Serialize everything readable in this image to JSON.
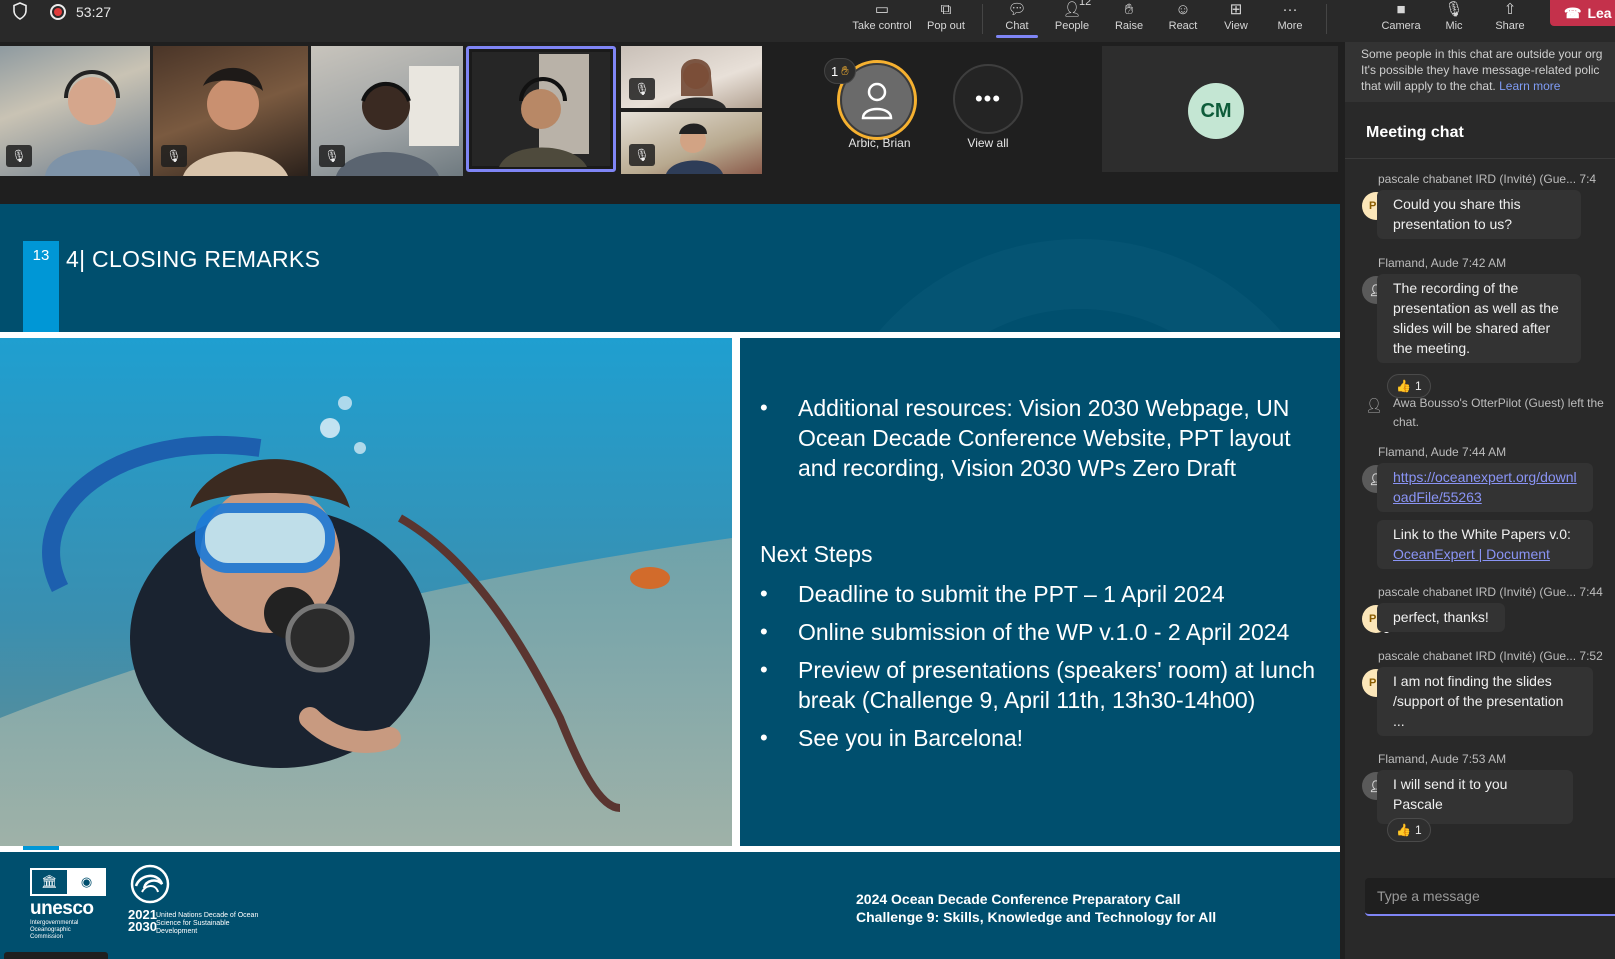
{
  "topbar": {
    "timer": "53:27",
    "buttons": [
      {
        "label": "Take control",
        "icon": "take-control-icon"
      },
      {
        "label": "Pop out",
        "icon": "pop-out-icon"
      },
      {
        "label": "Chat",
        "icon": "chat-icon"
      },
      {
        "label": "People",
        "icon": "people-icon",
        "badge": "12"
      },
      {
        "label": "Raise",
        "icon": "raise-hand-icon"
      },
      {
        "label": "React",
        "icon": "react-icon"
      },
      {
        "label": "View",
        "icon": "view-icon"
      },
      {
        "label": "More",
        "icon": "more-icon"
      },
      {
        "label": "Camera",
        "icon": "camera-icon"
      },
      {
        "label": "Mic",
        "icon": "mic-icon"
      },
      {
        "label": "Share",
        "icon": "share-icon"
      }
    ],
    "leave_label": "Lea"
  },
  "participants": {
    "raised_count": "1",
    "raised_name": "Arbic, Brian",
    "view_all": "View all",
    "cm_initials": "CM"
  },
  "slide": {
    "number": "13",
    "title": "4| CLOSING REMARKS",
    "resources": "Additional resources: Vision 2030 Webpage, UN Ocean Decade Conference Website, PPT layout and recording, Vision 2030 WPs Zero Draft",
    "next_steps_heading": "Next Steps",
    "steps": [
      "Deadline to submit the PPT – 1 April 2024",
      "Online submission of the WP v.1.0 - 2 April 2024",
      "Preview of presentations (speakers' room) at lunch break (Challenge 9, April 11th, 13h30-14h00)",
      "See you in Barcelona!"
    ],
    "footer_line1": "2024 Ocean Decade Conference Preparatory Call",
    "footer_line2": "Challenge 9: Skills, Knowledge and Technology for All",
    "unesco_word": "unesco",
    "unesco_sub": "Intergovernmental Oceanographic Commission",
    "decade_years": "2021\n2030",
    "decade_sub": "United Nations Decade of Ocean Science for Sustainable Development"
  },
  "chat": {
    "warning": "Some people in this chat are outside your org. It's possible they have message-related policies that will apply to the chat.",
    "warning_line1": "Some people in this chat are outside your org",
    "warning_line2": "It's possible they have message-related polic",
    "warning_line3": "that will apply to the chat.",
    "learn_more": "Learn more",
    "title": "Meeting chat",
    "messages": [
      {
        "meta": "pascale chabanet IRD (Invité) (Gue...  7:4",
        "text": "Could you share this presentation to us?"
      },
      {
        "meta": "Flamand, Aude  7:42 AM",
        "text": "The recording of the presentation as well as the slides will be shared after the meeting.",
        "reaction": "1"
      },
      {
        "system": "Awa Bousso's OtterPilot (Guest) left the chat."
      },
      {
        "meta": "Flamand, Aude  7:44 AM",
        "link": "https://oceanexpert.org/downloadFile/55263",
        "link_line1": "https://oceanexpert.org/downl",
        "link_line2": "oadFile/55263",
        "text2": "Link to the White Papers v.0:",
        "link2": "OceanExpert | Document"
      },
      {
        "meta": "pascale chabanet IRD (Invité) (Gue...  7:44",
        "text": "perfect, thanks!"
      },
      {
        "meta": "pascale chabanet IRD (Invité) (Gue...  7:52",
        "text": "I am not finding the slides /support of the presentation ..."
      },
      {
        "meta": "Flamand, Aude  7:53 AM",
        "text": "I will send it to you Pascale",
        "reaction": "1"
      }
    ],
    "avatar_pl": "PL",
    "input_placeholder": "Type a message"
  }
}
